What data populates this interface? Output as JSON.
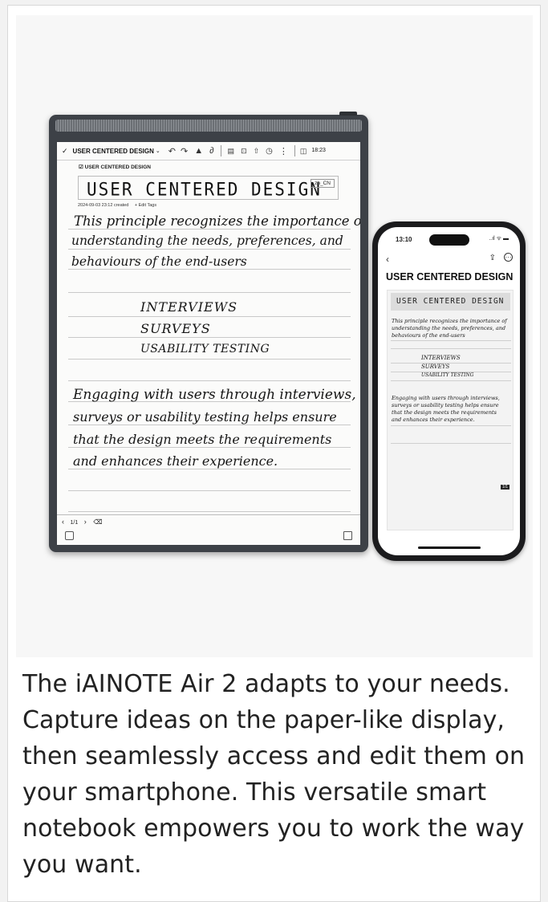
{
  "tablet": {
    "toolbar_title": "USER CENTERED DESIGN",
    "toolbar_time": "18:23",
    "doc_label": "USER CENTERED DESIGN",
    "title_handwriting": "USER CENTERED DESIGN",
    "lang_badge": "zh_CN",
    "meta_created": "2024-09-03 23:12 created",
    "meta_tags": "+ Edit Tags",
    "paragraph1": [
      "This principle recognizes the importance of",
      "understanding the needs, preferences, and",
      "behaviours of the end-users"
    ],
    "list": [
      "INTERVIEWS",
      "SURVEYS",
      "USABILITY TESTING"
    ],
    "paragraph2": [
      "Engaging with users through interviews,",
      "surveys or usability testing helps ensure",
      "that the design meets the requirements",
      "and enhances their experience."
    ],
    "pager": "1/1"
  },
  "phone": {
    "status_time": "13:10",
    "status_icons": "..ıl ᯤ ▬",
    "page_title": "USER CENTERED DESIGN",
    "title_handwriting": "USER CENTERED DESIGN",
    "paragraph1": [
      "This principle recognizes the importance of",
      "understanding the needs, preferences, and",
      "behaviours of the end-users"
    ],
    "list": [
      "INTERVIEWS",
      "SURVEYS",
      "USABILITY TESTING"
    ],
    "paragraph2": [
      "Engaging with users through interviews,",
      "surveys or usability testing helps ensure",
      "that the design meets the requirements",
      "and enhances their experience."
    ],
    "page_badge": "1/1"
  },
  "description": "The iAINOTE Air 2 adapts to your needs. Capture ideas on the paper-like display, then seamlessly access and edit them on your smartphone. This versatile smart notebook empowers you to work the way you want.",
  "icons": [
    "checkmark-icon",
    "undo-icon",
    "redo-icon",
    "pen-icon",
    "lasso-icon",
    "template-icon",
    "export-icon",
    "share-icon",
    "history-icon",
    "more-icon",
    "layers-icon",
    "note-icon",
    "back-icon",
    "more-circle-icon"
  ]
}
